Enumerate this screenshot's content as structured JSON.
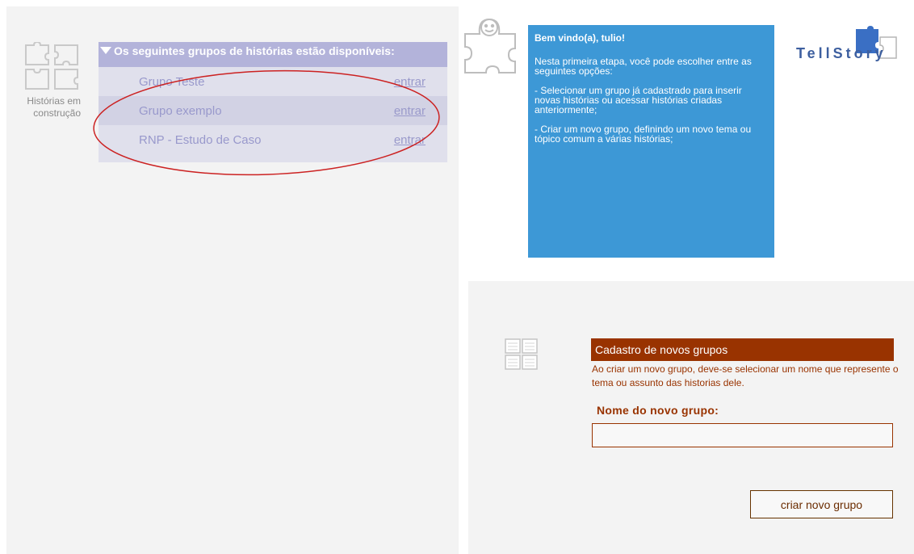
{
  "left": {
    "icon": "puzzle-pieces-icon",
    "caption_line1": "Histórias em",
    "caption_line2": "construção",
    "groups_header": "Os seguintes grupos de histórias estão disponíveis:",
    "groups": [
      {
        "name": "Grupo Teste",
        "link": "entrar"
      },
      {
        "name": "Grupo exemplo",
        "link": "entrar"
      },
      {
        "name": "RNP - Estudo de Caso",
        "link": "entrar"
      }
    ]
  },
  "welcome": {
    "icon": "smiley-puzzle-icon",
    "greeting": "Bem vindo(a), tulio!",
    "intro": "Nesta primeira etapa, você pode escolher entre as seguintes opções:",
    "option1": "- Selecionar um grupo já cadastrado para inserir novas histórias ou acessar histórias criadas anteriormente;",
    "option2": "- Criar um novo grupo, definindo um novo tema ou tópico comum a várias histórias;"
  },
  "logo": {
    "text": "TellStory",
    "icon": "tellstory-logo"
  },
  "cadastro": {
    "icon": "grid-pages-icon",
    "title": "Cadastro de novos grupos",
    "description": "Ao criar um novo grupo, deve-se selecionar um nome que represente o tema ou assunto das historias dele.",
    "field_label": "Nome do novo grupo:",
    "field_value": "",
    "button_label": "criar novo grupo"
  },
  "colors": {
    "accent_blue": "#3d98d6",
    "group_header": "#b3b3da",
    "brown": "#993300",
    "annotation_red": "#cc2222"
  }
}
